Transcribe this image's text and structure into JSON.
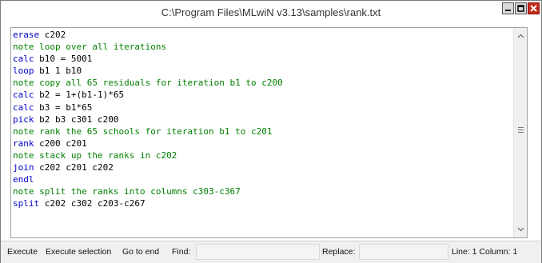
{
  "window": {
    "title": "C:\\Program Files\\MLwiN v3.13\\samples\\rank.txt"
  },
  "colors": {
    "keyword": "#0000cc",
    "comment": "#008000",
    "text": "#000000"
  },
  "editor": {
    "lines": [
      {
        "kw": "erase",
        "rest": " c202",
        "type": "command"
      },
      {
        "kw": "note",
        "rest": " loop over all iterations",
        "type": "note"
      },
      {
        "kw": "calc",
        "rest": " b10 = 5001",
        "type": "command"
      },
      {
        "kw": "loop",
        "rest": " b1 1 b10",
        "type": "command"
      },
      {
        "kw": "note",
        "rest": " copy all 65 residuals for iteration b1 to c200",
        "type": "note"
      },
      {
        "kw": "calc",
        "rest": " b2 = 1+(b1-1)*65",
        "type": "command"
      },
      {
        "kw": "calc",
        "rest": " b3 = b1*65",
        "type": "command"
      },
      {
        "kw": "pick",
        "rest": " b2 b3 c301 c200",
        "type": "command"
      },
      {
        "kw": "note",
        "rest": " rank the 65 schools for iteration b1 to c201",
        "type": "note"
      },
      {
        "kw": "rank",
        "rest": " c200 c201",
        "type": "command"
      },
      {
        "kw": "note",
        "rest": " stack up the ranks in c202",
        "type": "note"
      },
      {
        "kw": "join",
        "rest": " c202 c201 c202",
        "type": "command"
      },
      {
        "kw": "endl",
        "rest": "",
        "type": "command"
      },
      {
        "kw": "note",
        "rest": " split the ranks into columns c303-c367",
        "type": "note"
      },
      {
        "kw": "split",
        "rest": " c202 c302 c203-c267",
        "type": "command"
      }
    ]
  },
  "statusbar": {
    "execute": "Execute",
    "execute_selection": "Execute selection",
    "go_to_end": "Go to end",
    "find_label": "Find:",
    "find_value": "",
    "replace_label": "Replace:",
    "replace_value": "",
    "position": "Line: 1 Column: 1"
  }
}
